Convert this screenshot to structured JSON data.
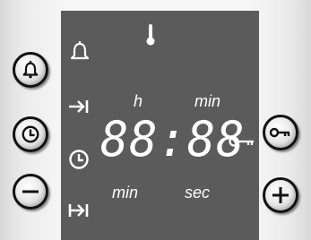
{
  "display": {
    "time_digits": "88:88",
    "labels": {
      "hours": "h",
      "minutes_top": "min",
      "minutes_bottom": "min",
      "seconds": "sec"
    }
  },
  "indicators": [
    "thermometer-icon",
    "bell-icon",
    "cooking-time-arrow-icon",
    "clock-icon",
    "end-time-arrow-icon",
    "key-lock-icon"
  ],
  "buttons": {
    "left": [
      "bell-button",
      "clock-button",
      "minus-button"
    ],
    "right": [
      "key-lock-button",
      "plus-button"
    ]
  },
  "colors": {
    "display_bg": "#5b5b5b",
    "display_fg": "#ffffff",
    "panel_bg": "#f4f4f4",
    "button_outline": "#111111"
  }
}
